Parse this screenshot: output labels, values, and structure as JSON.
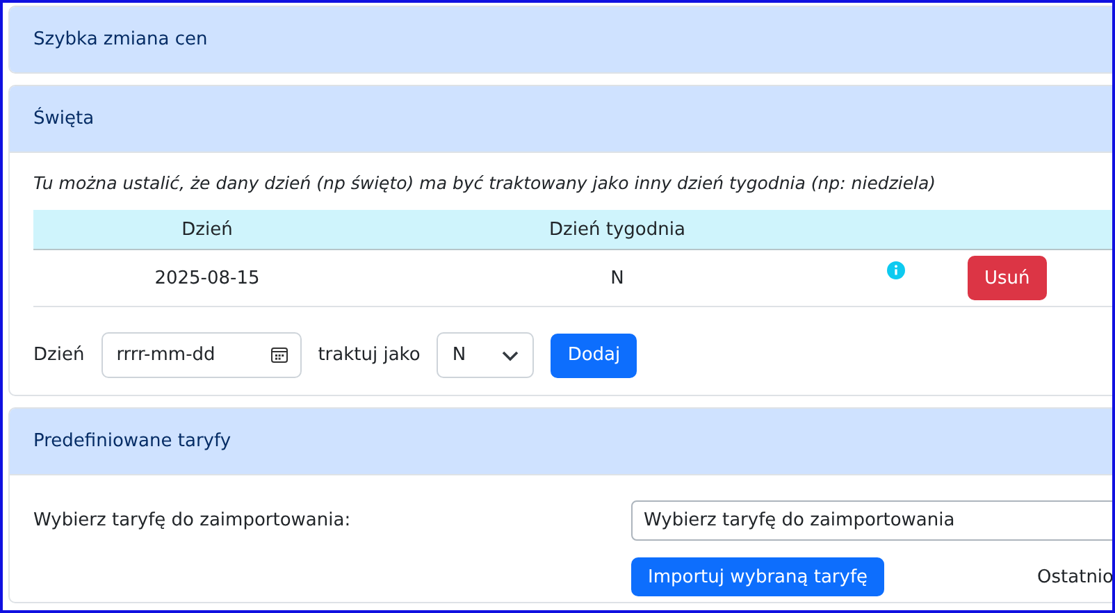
{
  "sections": [
    {
      "title": "Szybka zmiana cen",
      "kind": "collapsed"
    },
    {
      "title": "Święta",
      "kind": "holidays",
      "description": "Tu można ustalić, że dany dzień (np święto) ma być traktowany jako inny dzień tygodnia (np: niedziela)",
      "table": {
        "columns": [
          "Dzień",
          "Dzień tygodnia"
        ],
        "rows": [
          {
            "day": "2025-08-15",
            "weekday": "N",
            "delete_label": "Usuń"
          }
        ]
      },
      "form": {
        "day_label": "Dzień",
        "day_placeholder": "rrrr-mm-dd",
        "treat_label": "traktuj jako",
        "weekday_value": "N",
        "add_label": "Dodaj"
      }
    },
    {
      "title": "Predefiniowane taryfy",
      "kind": "tariffs",
      "select_label": "Wybierz taryfę do zaimportowania:",
      "select_value": "Wybierz taryfę do zaimportowania",
      "import_label": "Importuj wybraną taryfę",
      "side_text": "Ostatnio"
    }
  ]
}
